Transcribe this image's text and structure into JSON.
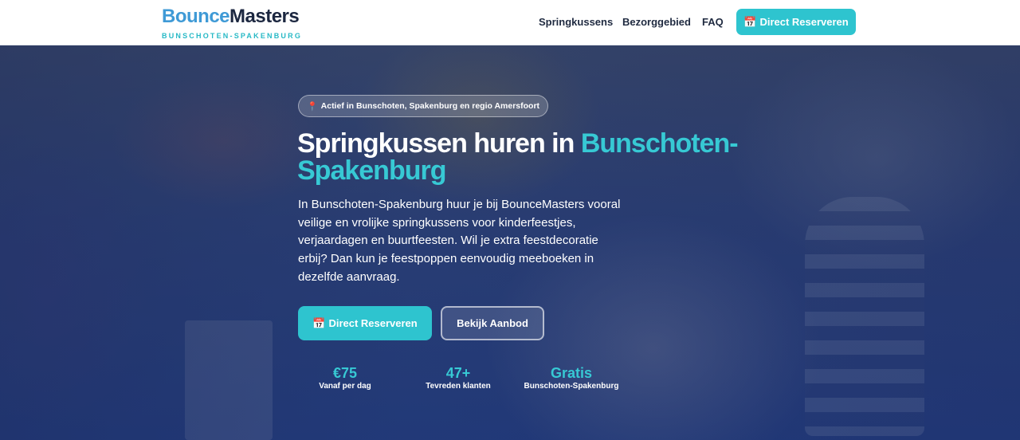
{
  "header": {
    "logo_part1": "Bounce",
    "logo_part2": "Masters",
    "logo_sub": "BUNSCHOTEN-SPAKENBURG",
    "nav": [
      {
        "label": "Springkussens"
      },
      {
        "label": "Bezorggebied"
      },
      {
        "label": "FAQ"
      }
    ],
    "cta_icon": "📅",
    "cta_label": "Direct Reserveren"
  },
  "hero": {
    "badge_icon": "📍",
    "badge_text": "Actief in Bunschoten, Spakenburg en regio Amersfoort",
    "title_main": "Springkussen huren in ",
    "title_accent": "Bunschoten-Spakenburg",
    "description": "In Bunschoten-Spakenburg huur je bij BounceMasters vooral veilige en vrolijke springkussens voor kinderfeestjes, verjaardagen en buurtfeesten. Wil je extra feestdecoratie erbij? Dan kun je feestpoppen eenvoudig meeboeken in dezelfde aanvraag.",
    "primary_icon": "📅",
    "primary_label": "Direct Reserveren",
    "secondary_label": "Bekijk Aanbod",
    "stats": [
      {
        "value": "€75",
        "label": "Vanaf per dag"
      },
      {
        "value": "47+",
        "label": "Tevreden klanten"
      },
      {
        "value": "Gratis",
        "label": "Bunschoten-Spakenburg"
      }
    ]
  },
  "colors": {
    "accent": "#2ec4cf",
    "brand_blue": "#3f9ad6",
    "brand_dark": "#1c2740"
  }
}
